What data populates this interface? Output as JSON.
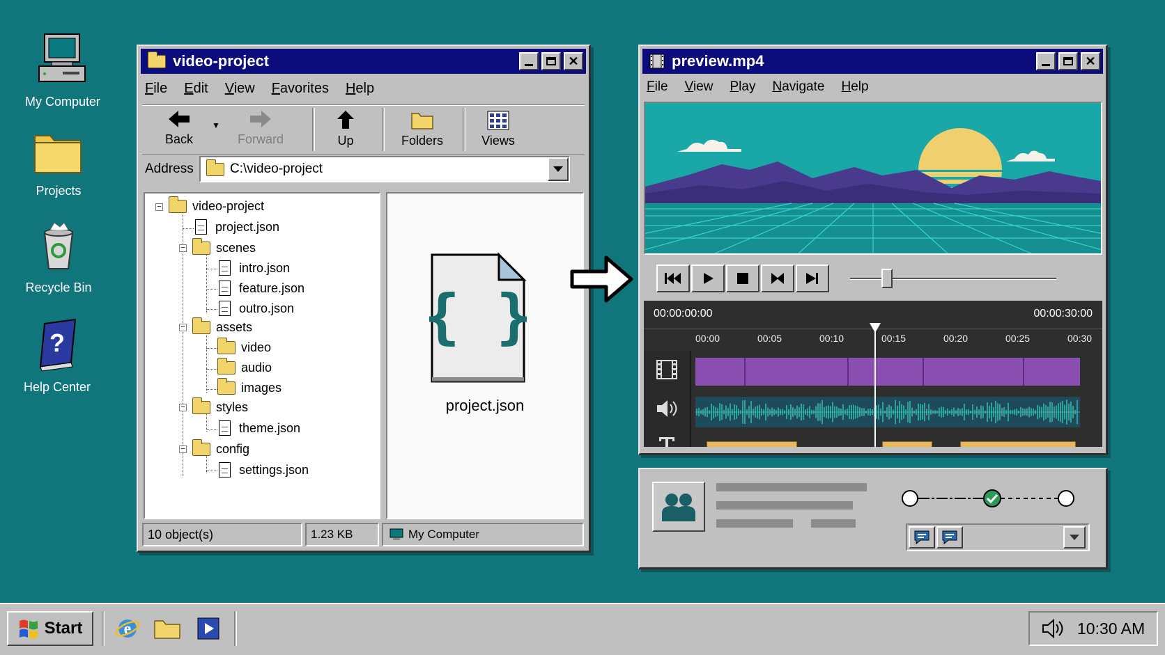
{
  "desktop": {
    "icons": [
      {
        "label": "My Computer",
        "icon": "computer-icon"
      },
      {
        "label": "Projects",
        "icon": "folder-icon"
      },
      {
        "label": "Recycle Bin",
        "icon": "recycle-bin-icon"
      },
      {
        "label": "Help Center",
        "icon": "help-book-icon"
      }
    ]
  },
  "explorer": {
    "title": "video-project",
    "menu": [
      "File",
      "Edit",
      "View",
      "Favorites",
      "Help"
    ],
    "toolbar": {
      "back": "Back",
      "forward": "Forward",
      "up": "Up",
      "folders": "Folders",
      "views": "Views"
    },
    "address": {
      "label": "Address",
      "value": "C:\\video-project"
    },
    "tree": [
      {
        "label": "video-project",
        "type": "folder"
      },
      {
        "label": "project.json",
        "type": "file"
      },
      {
        "label": "scenes",
        "type": "folder"
      },
      {
        "label": "intro.json",
        "type": "file"
      },
      {
        "label": "feature.json",
        "type": "file"
      },
      {
        "label": "outro.json",
        "type": "file"
      },
      {
        "label": "assets",
        "type": "folder"
      },
      {
        "label": "video",
        "type": "folder"
      },
      {
        "label": "audio",
        "type": "folder"
      },
      {
        "label": "images",
        "type": "folder"
      },
      {
        "label": "styles",
        "type": "folder"
      },
      {
        "label": "theme.json",
        "type": "file"
      },
      {
        "label": "config",
        "type": "folder"
      },
      {
        "label": "settings.json",
        "type": "file"
      }
    ],
    "preview": {
      "file_name": "project.json",
      "glyph": "{ }"
    },
    "status": {
      "objects": "10 object(s)",
      "size": "1.23 KB",
      "location": "My Computer"
    }
  },
  "player": {
    "title": "preview.mp4",
    "menu": [
      "File",
      "View",
      "Play",
      "Navigate",
      "Help"
    ],
    "seek_position": 0.16,
    "timeline": {
      "start": "00:00:00:00",
      "end": "00:00:30:00",
      "ticks": [
        "00:00",
        "00:05",
        "00:10",
        "00:15",
        "00:20",
        "00:25",
        "00:30"
      ],
      "playhead": "00:14",
      "track_icons": [
        "film-icon",
        "speaker-icon",
        "text-icon"
      ]
    }
  },
  "workflow": {
    "steps": 3,
    "completed_step": 2
  },
  "taskbar": {
    "start": "Start",
    "clock": "10:30 AM",
    "quick_launch": [
      "browser-icon",
      "folder-icon",
      "media-player-icon"
    ]
  },
  "colors": {
    "desktop": "#11757c",
    "titlebar": "#0c0c7c",
    "video_track": "#8a4fb0",
    "audio_wave": "#2fb7b0",
    "text_track": "#e8b860"
  }
}
